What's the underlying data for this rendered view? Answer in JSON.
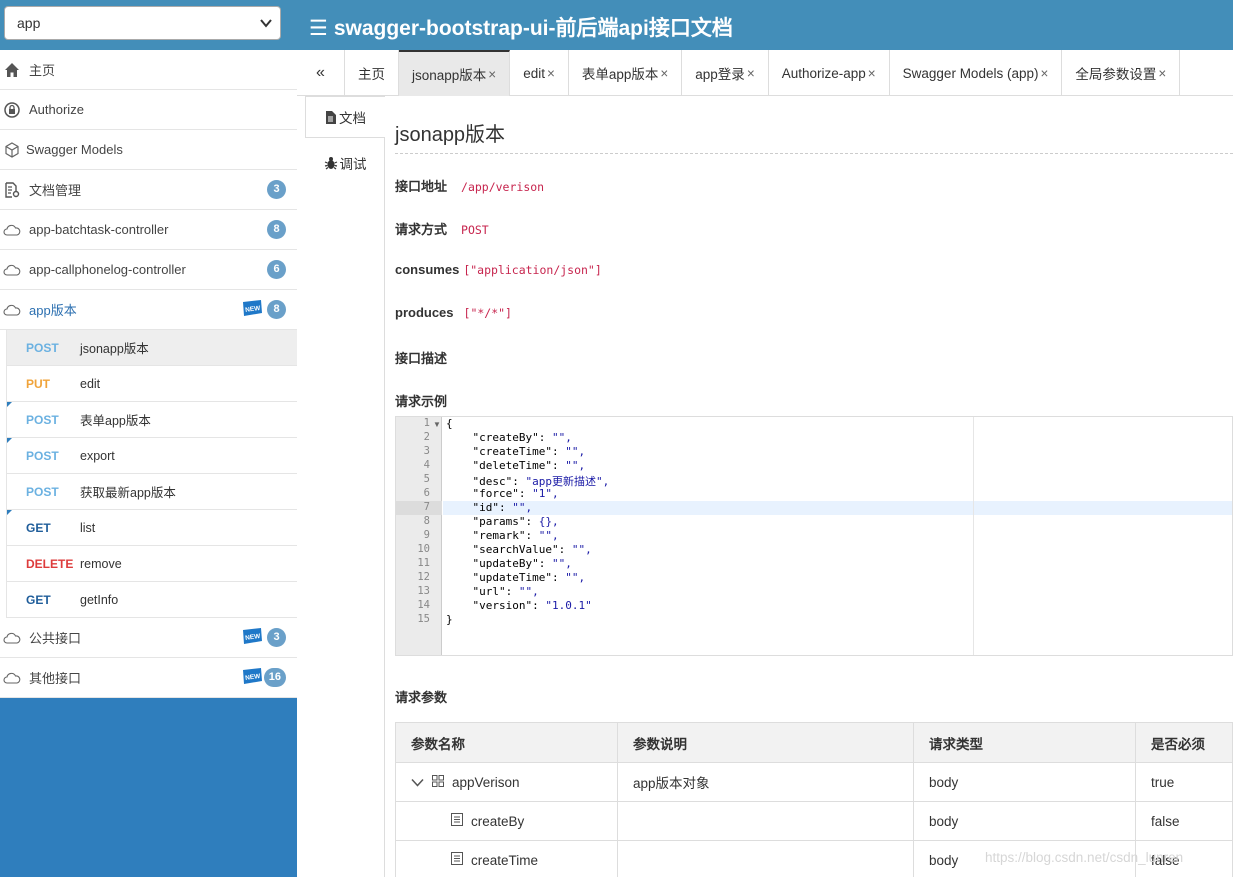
{
  "header": {
    "group_select_value": "app",
    "title": "swagger-bootstrap-ui-前后端api接口文档",
    "menu_icon": "hamburger-menu-icon"
  },
  "sidebar": {
    "items": [
      {
        "label": "主页",
        "icon": "home-icon"
      },
      {
        "label": "Authorize",
        "icon": "lock-icon"
      },
      {
        "label": "Swagger Models",
        "icon": "cube-icon"
      },
      {
        "label": "文档管理",
        "icon": "doc-settings-icon",
        "badge": "3"
      },
      {
        "label": "app-batchtask-controller",
        "icon": "cloud-api-icon",
        "badge": "8"
      },
      {
        "label": "app-callphonelog-controller",
        "icon": "cloud-api-icon",
        "badge": "6"
      },
      {
        "label": "app版本",
        "icon": "cloud-api-icon",
        "badge": "8",
        "new": "NEW"
      }
    ],
    "apis": [
      {
        "method": "POST",
        "name": "jsonapp版本"
      },
      {
        "method": "PUT",
        "name": "edit"
      },
      {
        "method": "POST",
        "name": "表单app版本"
      },
      {
        "method": "POST",
        "name": "export"
      },
      {
        "method": "POST",
        "name": "获取最新app版本"
      },
      {
        "method": "GET",
        "name": "list"
      },
      {
        "method": "DELETE",
        "name": "remove"
      },
      {
        "method": "GET",
        "name": "getInfo"
      }
    ],
    "bottom_items": [
      {
        "label": "公共接口",
        "icon": "cloud-api-icon",
        "badge": "3",
        "new": "NEW"
      },
      {
        "label": "其他接口",
        "icon": "cloud-api-icon",
        "badge": "16",
        "new": "NEW"
      }
    ]
  },
  "tabs": {
    "collapse": "«",
    "items": [
      {
        "label": "主页",
        "close": ""
      },
      {
        "label": "jsonapp版本",
        "close": "×"
      },
      {
        "label": "edit",
        "close": "×"
      },
      {
        "label": "表单app版本",
        "close": "×"
      },
      {
        "label": "app登录",
        "close": "×"
      },
      {
        "label": "Authorize-app",
        "close": "×"
      },
      {
        "label": "Swagger Models (app)",
        "close": "×"
      },
      {
        "label": "全局参数设置",
        "close": "×"
      }
    ]
  },
  "doc_side": {
    "doc_label": "文档",
    "debug_label": "调试"
  },
  "content": {
    "title": "jsonapp版本",
    "url_label": "接口地址",
    "url": "/app/verison",
    "method_label": "请求方式",
    "method": "POST",
    "consumes_label": "consumes",
    "consumes": "[\"application/json\"]",
    "produces_label": "produces",
    "produces": "[\"*/*\"]",
    "desc_label": "接口描述",
    "example_label": "请求示例",
    "params_label": "请求参数"
  },
  "code": {
    "line_numbers": [
      "1",
      "2",
      "3",
      "4",
      "5",
      "6",
      "7",
      "8",
      "9",
      "10",
      "11",
      "12",
      "13",
      "14",
      "15"
    ],
    "lines": [
      {
        "key": "{",
        "val": ""
      },
      {
        "key": "    \"createBy\": ",
        "val": "\"\","
      },
      {
        "key": "    \"createTime\": ",
        "val": "\"\","
      },
      {
        "key": "    \"deleteTime\": ",
        "val": "\"\","
      },
      {
        "key": "    \"desc\": ",
        "val": "\"app更新描述\","
      },
      {
        "key": "    \"force\": ",
        "val": "\"1\","
      },
      {
        "key": "    \"id\": ",
        "val": "\"\","
      },
      {
        "key": "    \"params\": ",
        "val": "{},"
      },
      {
        "key": "    \"remark\": ",
        "val": "\"\","
      },
      {
        "key": "    \"searchValue\": ",
        "val": "\"\","
      },
      {
        "key": "    \"updateBy\": ",
        "val": "\"\","
      },
      {
        "key": "    \"updateTime\": ",
        "val": "\"\","
      },
      {
        "key": "    \"url\": ",
        "val": "\"\","
      },
      {
        "key": "    \"version\": ",
        "val": "\"1.0.1\""
      },
      {
        "key": "}",
        "val": ""
      }
    ]
  },
  "params_table": {
    "headers": [
      "参数名称",
      "参数说明",
      "请求类型",
      "是否必须"
    ],
    "rows": [
      {
        "name": "appVerison",
        "desc": "app版本对象",
        "type": "body",
        "required": "true"
      },
      {
        "name": "createBy",
        "desc": "",
        "type": "body",
        "required": "false"
      },
      {
        "name": "createTime",
        "desc": "",
        "type": "body",
        "required": "false"
      }
    ]
  },
  "watermark": "https://blog.csdn.net/csdn_lunren"
}
